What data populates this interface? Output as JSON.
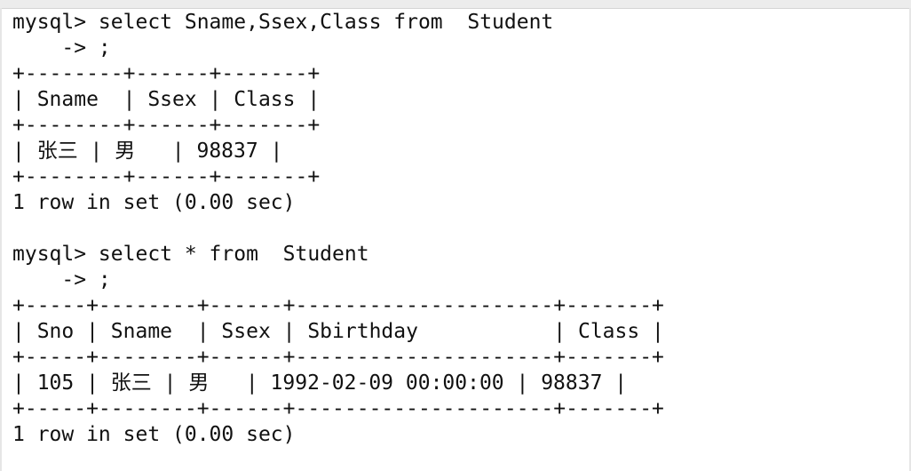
{
  "terminal": {
    "lines": [
      {
        "kind": "prompt",
        "text": "mysql> select Sname,Ssex,Class from  Student"
      },
      {
        "kind": "continuation",
        "text": "    -> ;"
      },
      {
        "kind": "border",
        "text": "+--------+------+-------+"
      },
      {
        "kind": "table-header",
        "text": "| Sname  | Ssex | Class |"
      },
      {
        "kind": "border",
        "text": "+--------+------+-------+"
      },
      {
        "kind": "table-row",
        "text": "| 张三 | 男   | 98837 |"
      },
      {
        "kind": "border",
        "text": "+--------+------+-------+"
      },
      {
        "kind": "result-summary",
        "text": "1 row in set (0.00 sec)"
      },
      {
        "kind": "blank",
        "text": ""
      },
      {
        "kind": "prompt",
        "text": "mysql> select * from  Student"
      },
      {
        "kind": "continuation",
        "text": "    -> ;"
      },
      {
        "kind": "border",
        "text": "+-----+--------+------+---------------------+-------+"
      },
      {
        "kind": "table-header",
        "text": "| Sno | Sname  | Ssex | Sbirthday           | Class |"
      },
      {
        "kind": "border",
        "text": "+-----+--------+------+---------------------+-------+"
      },
      {
        "kind": "table-row",
        "text": "| 105 | 张三 | 男   | 1992-02-09 00:00:00 | 98837 |"
      },
      {
        "kind": "border",
        "text": "+-----+--------+------+---------------------+-------+"
      },
      {
        "kind": "result-summary",
        "text": "1 row in set (0.00 sec)"
      }
    ]
  },
  "colors": {
    "background": "#ffffff",
    "text": "#111111"
  }
}
